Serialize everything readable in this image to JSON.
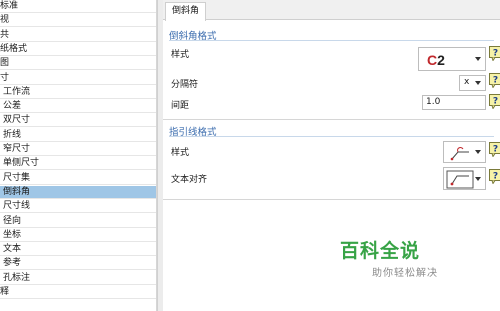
{
  "tree": {
    "items": [
      {
        "label": "标准",
        "indent": 0
      },
      {
        "label": "视",
        "indent": 0
      },
      {
        "label": "共",
        "indent": 0
      },
      {
        "label": "纸格式",
        "indent": 0
      },
      {
        "label": "图",
        "indent": 0
      },
      {
        "label": "寸",
        "indent": 0
      },
      {
        "label": "工作流",
        "indent": 1
      },
      {
        "label": "公差",
        "indent": 1
      },
      {
        "label": "双尺寸",
        "indent": 1
      },
      {
        "label": "折线",
        "indent": 1
      },
      {
        "label": "窄尺寸",
        "indent": 1
      },
      {
        "label": "单侧尺寸",
        "indent": 1
      },
      {
        "label": "尺寸集",
        "indent": 1
      },
      {
        "label": "倒斜角",
        "indent": 1,
        "selected": true
      },
      {
        "label": "尺寸线",
        "indent": 1
      },
      {
        "label": "径向",
        "indent": 1
      },
      {
        "label": "坐标",
        "indent": 1
      },
      {
        "label": "文本",
        "indent": 1
      },
      {
        "label": "参考",
        "indent": 1
      },
      {
        "label": "孔标注",
        "indent": 1
      },
      {
        "label": "释",
        "indent": 0
      }
    ]
  },
  "panel": {
    "tab": "倒斜角",
    "chamfer_format": {
      "title": "倒斜角格式",
      "style_label": "样式",
      "style_value": "C2",
      "separator_label": "分隔符",
      "separator_value": "x",
      "spacing_label": "间距",
      "spacing_value": "1.0"
    },
    "leader_format": {
      "title": "指引线格式",
      "style_label": "样式",
      "text_align_label": "文本对齐"
    },
    "help_glyph": "?"
  },
  "watermark": {
    "title": "百科全说",
    "subtitle": "助你轻松解决"
  },
  "colors": {
    "selected_row": "#9fc6e6",
    "section_title": "#3b6cae",
    "c2_red": "#c0282c",
    "help_yellow": "#f6f2a8",
    "watermark_green": "#37a346"
  }
}
